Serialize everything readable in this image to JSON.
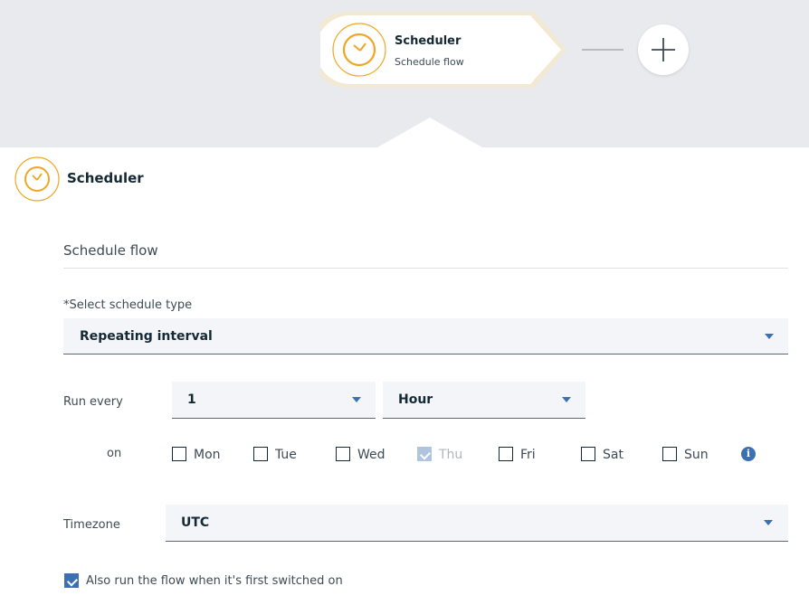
{
  "flow_node": {
    "title": "Scheduler",
    "subtitle": "Schedule flow",
    "icon": "clock-icon",
    "accent_color": "#f0a623"
  },
  "add_node": {
    "icon": "plus-icon"
  },
  "panel": {
    "title": "Scheduler",
    "icon": "clock-icon",
    "name_value": "Schedule flow"
  },
  "schedule_type": {
    "label": "*Select schedule type",
    "value": "Repeating interval"
  },
  "run_every": {
    "label": "Run every",
    "interval_value": "1",
    "unit_value": "Hour"
  },
  "days": {
    "label": "on",
    "items": [
      {
        "label": "Mon",
        "checked": false,
        "disabled": false
      },
      {
        "label": "Tue",
        "checked": false,
        "disabled": false
      },
      {
        "label": "Wed",
        "checked": false,
        "disabled": false
      },
      {
        "label": "Thu",
        "checked": true,
        "disabled": true
      },
      {
        "label": "Fri",
        "checked": false,
        "disabled": false
      },
      {
        "label": "Sat",
        "checked": false,
        "disabled": false
      },
      {
        "label": "Sun",
        "checked": false,
        "disabled": false
      }
    ],
    "info_icon": "info-icon"
  },
  "timezone": {
    "label": "Timezone",
    "value": "UTC"
  },
  "first_run": {
    "label": "Also run the flow when it's first switched on",
    "checked": true
  },
  "colors": {
    "accent": "#f0a623",
    "primary": "#3d70b2",
    "field_bg": "#f3f5f9",
    "header_bg": "#e9eaed"
  }
}
